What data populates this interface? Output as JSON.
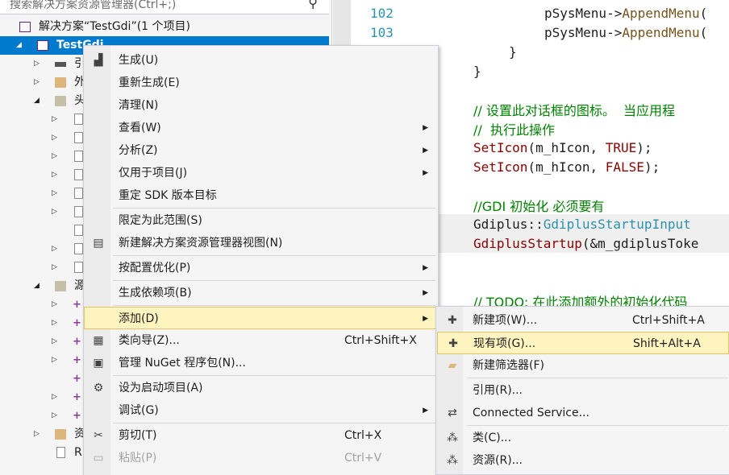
{
  "solution_explorer": {
    "search_placeholder": "搜索解决方案资源管理器(Ctrl+;)",
    "solution_label": "解决方案“TestGdi”(1 个项目)",
    "project_label": "TestGdi",
    "partial_labels": [
      "引",
      "外",
      "头",
      "源",
      "资"
    ],
    "file_partial": "R"
  },
  "editor": {
    "line_numbers": [
      "102",
      "103"
    ],
    "lines": {
      "l1_obj": "pSysMenu->",
      "l1_fn": "AppendMenu",
      "l1_rest": "(",
      "l2_obj": "pSysMenu->",
      "l2_fn": "AppendMenu",
      "l2_rest": "(",
      "close_inner": "}",
      "close_outer": "}",
      "comment1": "// 设置此对话框的图标。  当应用程",
      "comment2": "//  执行此操作",
      "seticon1_fn": "SetIcon",
      "seticon1_args": "(m_hIcon, ",
      "seticon1_kw": "TRUE",
      "seticon1_end": ");",
      "seticon2_fn": "SetIcon",
      "seticon2_args": "(m_hIcon, ",
      "seticon2_kw": "FALSE",
      "seticon2_end": ");",
      "comment3": "//GDI 初始化 必须要有",
      "gdi1_ns": "Gdiplus::",
      "gdi1_ty": "GdiplusStartupInput",
      "gdi2_fn": "GdiplusStartup",
      "gdi2_rest": "(&m_gdiplusToke",
      "comment4": "// TODO: 在此添加额外的初始化代码"
    }
  },
  "context_menu": {
    "items": [
      {
        "label": "生成(U)",
        "icon": "build-icon"
      },
      {
        "label": "重新生成(E)"
      },
      {
        "label": "清理(N)"
      },
      {
        "label": "查看(W)",
        "submenu": true
      },
      {
        "label": "分析(Z)",
        "submenu": true
      },
      {
        "label": "仅用于项目(J)",
        "submenu": true
      },
      {
        "label": "重定 SDK 版本目标"
      },
      {
        "label": "限定为此范围(S)"
      },
      {
        "label": "新建解决方案资源管理器视图(N)",
        "icon": "new-view-icon"
      },
      {
        "label": "按配置优化(P)",
        "submenu": true
      },
      {
        "label": "生成依赖项(B)",
        "submenu": true
      },
      {
        "label": "添加(D)",
        "submenu": true,
        "highlighted": true
      },
      {
        "label": "类向导(Z)...",
        "shortcut": "Ctrl+Shift+X",
        "icon": "class-wizard-icon"
      },
      {
        "label": "管理 NuGet 程序包(N)...",
        "icon": "nuget-icon"
      },
      {
        "label": "设为启动项目(A)",
        "icon": "gear-icon"
      },
      {
        "label": "调试(G)",
        "submenu": true
      },
      {
        "label": "剪切(T)",
        "shortcut": "Ctrl+X",
        "icon": "scissors-icon"
      },
      {
        "label": "粘贴(P)",
        "shortcut": "Ctrl+V",
        "disabled": true,
        "icon": "paste-icon"
      }
    ]
  },
  "add_submenu": {
    "items": [
      {
        "label": "新建项(W)...",
        "shortcut": "Ctrl+Shift+A",
        "icon": "new-item-icon"
      },
      {
        "label": "现有项(G)...",
        "shortcut": "Shift+Alt+A",
        "icon": "existing-item-icon",
        "highlighted": true
      },
      {
        "label": "新建筛选器(F)",
        "icon": "new-filter-icon"
      },
      {
        "label": "引用(R)..."
      },
      {
        "label": "Connected Service...",
        "icon": "connected-service-icon"
      },
      {
        "label": "类(C)...",
        "icon": "class-icon"
      },
      {
        "label": "资源(R)...",
        "icon": "resource-icon"
      }
    ]
  },
  "colors": {
    "selection_blue": "#007acc",
    "menu_highlight": "#fdf4bf",
    "comment_green": "#008000",
    "line_number": "#2b91af"
  }
}
